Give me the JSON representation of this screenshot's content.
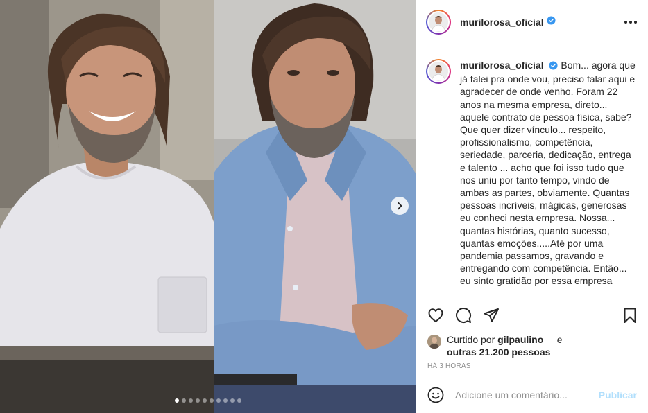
{
  "post": {
    "username": "murilorosa_oficial",
    "verified": true,
    "caption": "Bom... agora que já falei pra onde vou, preciso falar aqui e agradecer de onde venho. Foram 22 anos na mesma empresa, direto... aquele contrato de pessoa física, sabe? Que quer dizer vínculo... respeito, profissionalismo, competência, seriedade, parceria, dedicação, entrega e talento ... acho que foi isso tudo que nos uniu por tanto tempo, vindo de ambas as partes, obviamente. Quantas pessoas incríveis, mágicas, generosas eu conheci nesta empresa. Nossa... quantas histórias, quanto sucesso, quantas emoções.....Até por uma pandemia passamos, gravando e entregando com competência. Então... eu sinto gratidão por essa empresa"
  },
  "media": {
    "slide_count": 10,
    "active_slide": 1
  },
  "likes": {
    "prefix": "Curtido por",
    "user": "gilpaulino__",
    "joiner": "e",
    "others": "outras 21.200 pessoas"
  },
  "timestamp": "HÁ 3 HORAS",
  "comment_box": {
    "placeholder": "Adicione um comentário...",
    "publish_label": "Publicar"
  },
  "icons": {
    "like": "heart-icon",
    "comment": "comment-icon",
    "share": "share-icon",
    "save": "bookmark-icon",
    "emoji": "smiley-icon",
    "more": "more-options-icon",
    "next": "chevron-right-icon",
    "verified": "verified-badge-icon"
  },
  "colors": {
    "verified": "#3897f0",
    "publish_disabled": "#b2dffc",
    "secondary_text": "#8e8e8e",
    "divider": "#efefef"
  }
}
